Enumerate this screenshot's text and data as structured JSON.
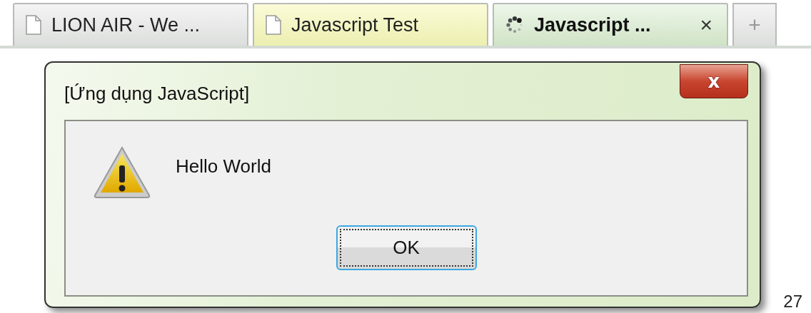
{
  "tabs": [
    {
      "label": "LION AIR - We ...",
      "selected": false,
      "highlighted": false,
      "loading": false
    },
    {
      "label": "Javascript Test",
      "selected": false,
      "highlighted": true,
      "loading": false
    },
    {
      "label": "Javascript ...",
      "selected": true,
      "highlighted": false,
      "loading": true,
      "close_label": "×"
    }
  ],
  "new_tab": {
    "label": "+"
  },
  "dialog": {
    "title": "[Ứng dụng JavaScript]",
    "close_label": "x",
    "message": "Hello World",
    "kind": "warning",
    "buttons": [
      {
        "label": "OK",
        "focused": true
      }
    ]
  },
  "page_number": "27"
}
